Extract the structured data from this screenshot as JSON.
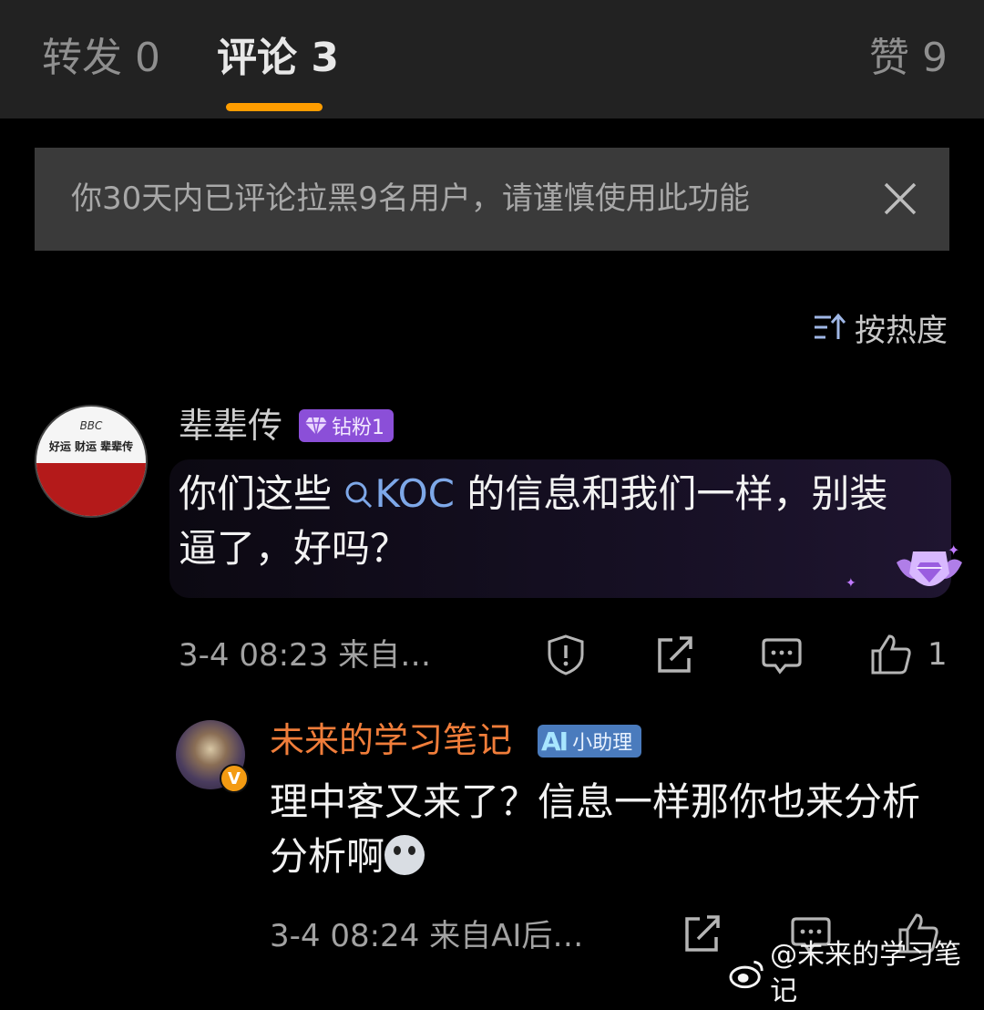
{
  "tabs": {
    "repost": "转发 0",
    "comments": "评论 3",
    "likes": "赞 9"
  },
  "notice": {
    "text": "你30天内已评论拉黑9名用户，请谨慎使用此功能"
  },
  "sort": {
    "label": "按热度"
  },
  "comments": [
    {
      "author": "辈辈传",
      "badge": "钻粉1",
      "avatar_slogan": "好运 财运 辈辈传",
      "avatar_logo": "BBC",
      "text_before": "你们这些 ",
      "topic": "KOC",
      "text_after": " 的信息和我们一样，别装逼了，好吗？",
      "meta": "3-4 08:23  来自…",
      "like_count": "1"
    }
  ],
  "reply": {
    "author": "未来的学习笔记",
    "badge_prefix": "AI",
    "badge": "小助理",
    "verified": "V",
    "text": "理中客又来了？信息一样那你也来分析分析啊",
    "meta": "3-4 08:24  来自AI后…"
  },
  "watermark": "@未来的学习笔记",
  "colors": {
    "accent": "#ff9d00",
    "diamond_badge": "#8b4fd8",
    "ai_badge": "#4a7bbd",
    "reply_author": "#f07d3a",
    "topic_link": "#7ea8e8"
  },
  "icons": [
    "close-icon",
    "sort-icon",
    "diamond-icon",
    "search-icon",
    "trophy-icon",
    "report-icon",
    "share-icon",
    "comment-icon",
    "like-icon",
    "weibo-icon"
  ]
}
